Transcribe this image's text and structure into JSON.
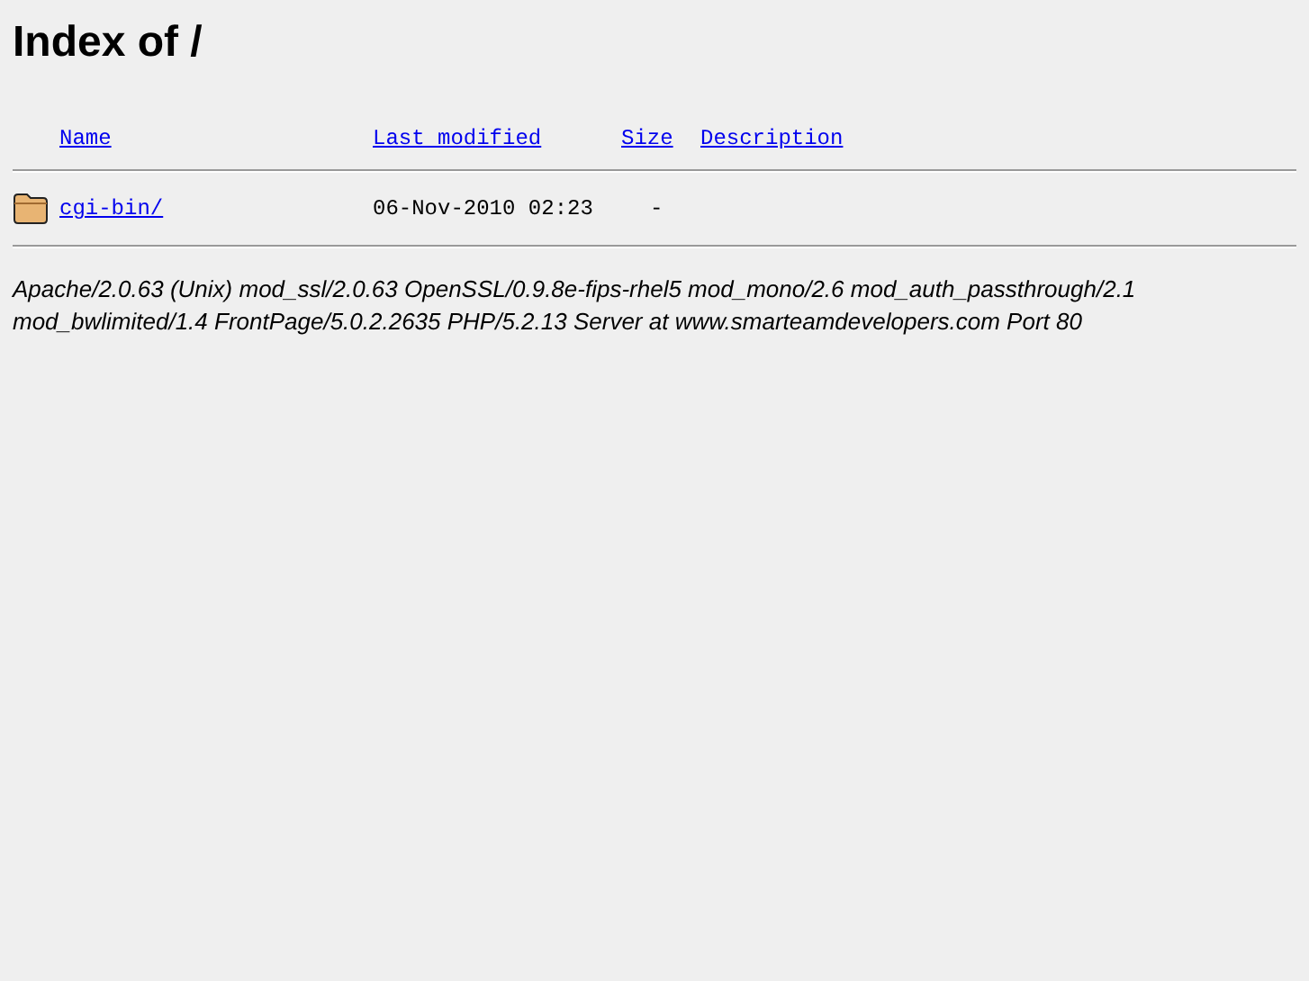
{
  "title": "Index of /",
  "columns": [
    "Name",
    "Last modified",
    "Size",
    "Description"
  ],
  "rows": [
    {
      "kind": "folder",
      "name": "cgi-bin/",
      "modified": "06-Nov-2010 02:23",
      "size": "-"
    }
  ],
  "address": "Apache/2.0.63 (Unix) mod_ssl/2.0.63 OpenSSL/0.9.8e-fips-rhel5 mod_mono/2.6 mod_auth_passthrough/2.1 mod_bwlimited/1.4 FrontPage/5.0.2.2635 PHP/5.2.13 Server at www.smarteamdevelopers.com Port 80"
}
